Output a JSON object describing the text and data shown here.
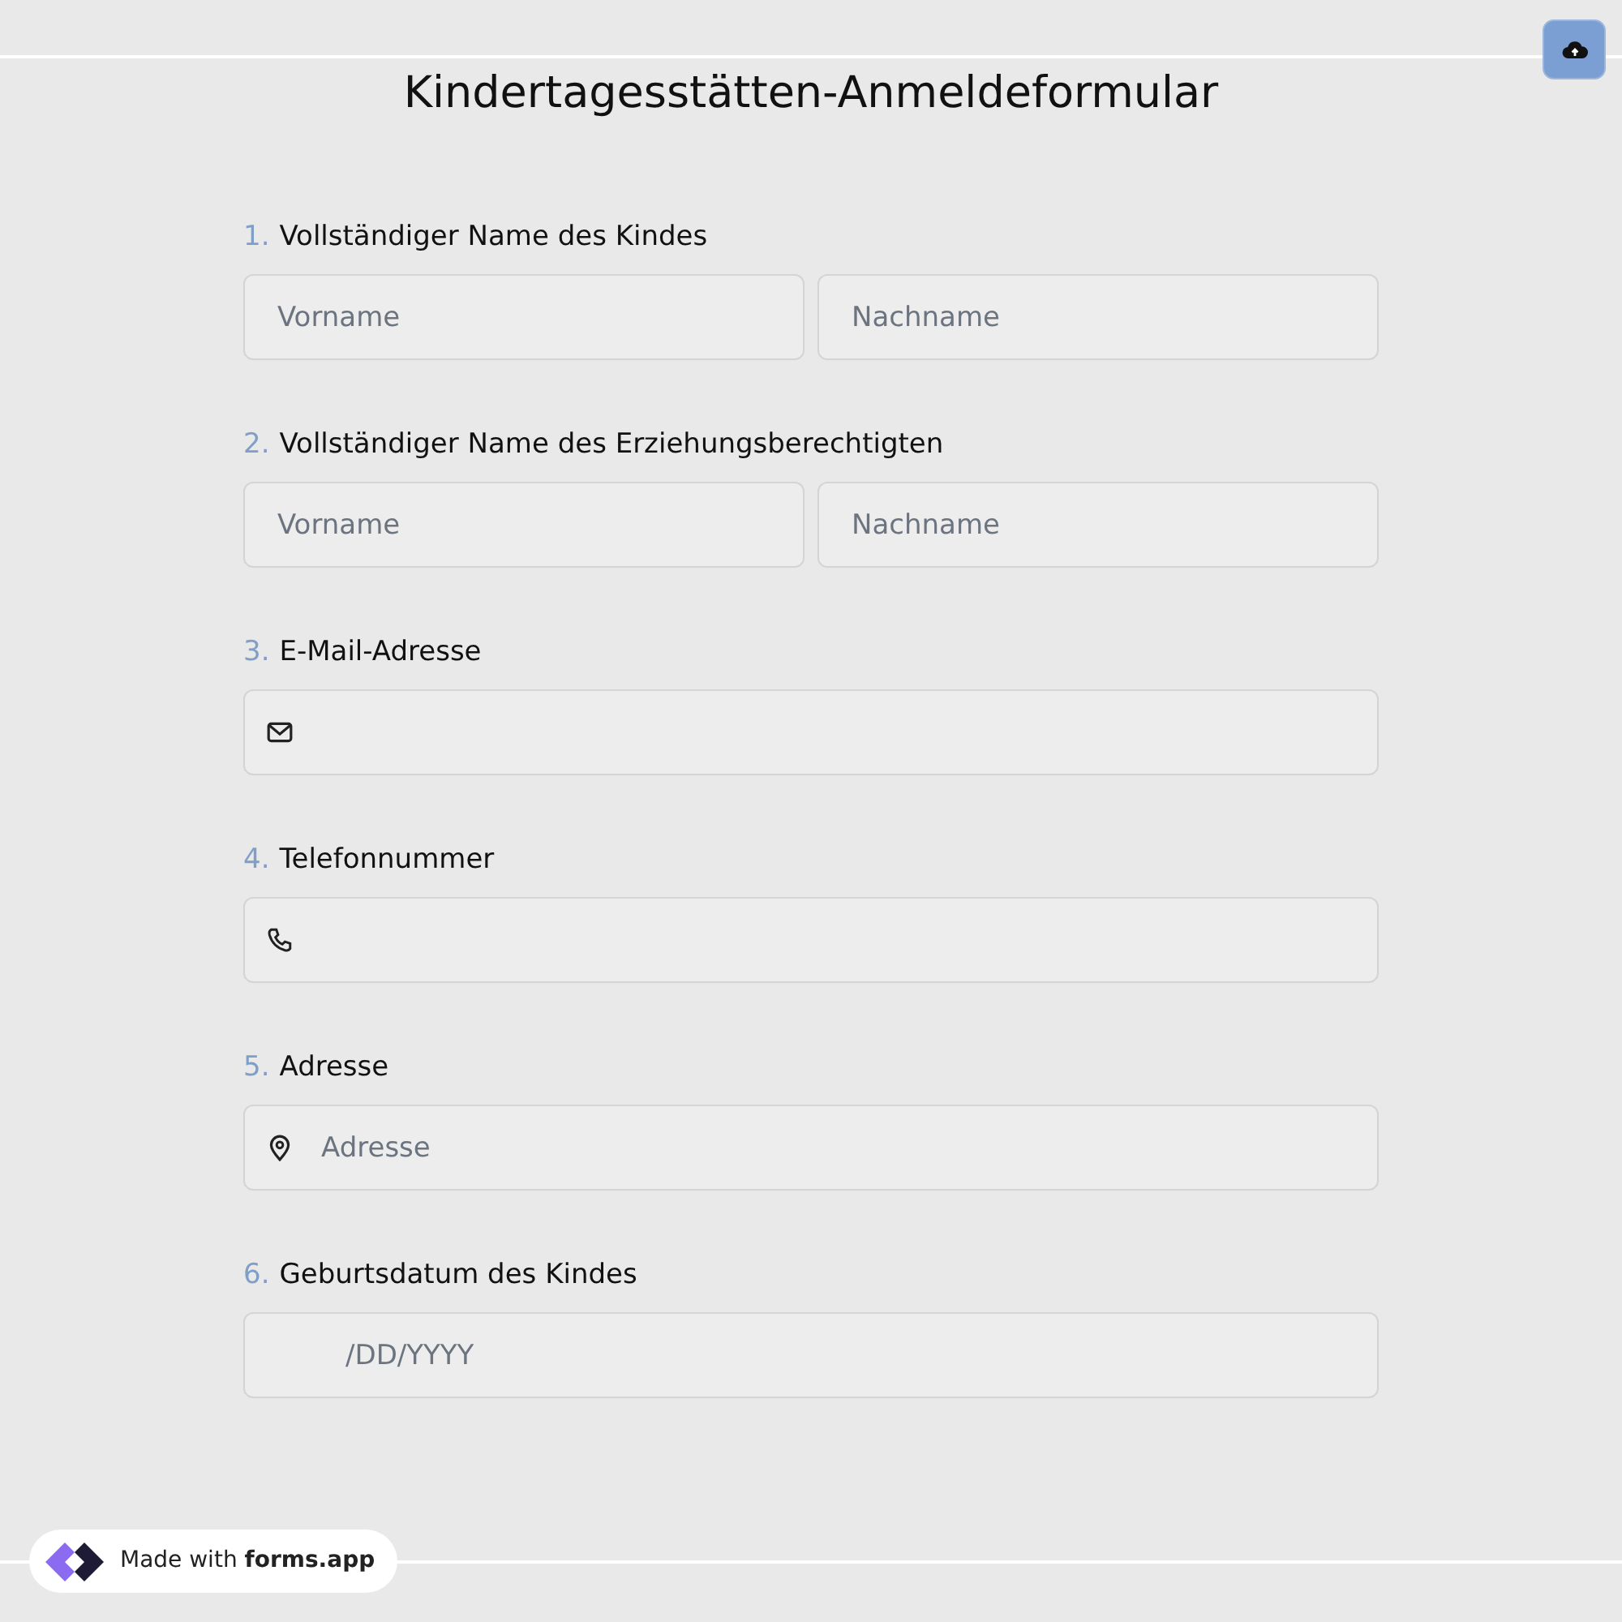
{
  "title": "Kindertagesstätten-Anmeldeformular",
  "questions": [
    {
      "number": "1.",
      "label": "Vollständiger Name des Kindes",
      "kind": "name",
      "fields": [
        {
          "placeholder": "Vorname"
        },
        {
          "placeholder": "Nachname"
        }
      ]
    },
    {
      "number": "2.",
      "label": "Vollständiger Name des Erziehungsberechtigten",
      "kind": "name",
      "fields": [
        {
          "placeholder": "Vorname"
        },
        {
          "placeholder": "Nachname"
        }
      ]
    },
    {
      "number": "3.",
      "label": "E-Mail-Adresse",
      "kind": "email"
    },
    {
      "number": "4.",
      "label": "Telefonnummer",
      "kind": "phone"
    },
    {
      "number": "5.",
      "label": "Adresse",
      "kind": "address",
      "fields": [
        {
          "placeholder": "Adresse"
        }
      ]
    },
    {
      "number": "6.",
      "label": "Geburtsdatum des Kindes",
      "kind": "date",
      "fields": [
        {
          "placeholder": "/DD/YYYY"
        }
      ]
    }
  ],
  "badge": {
    "text": "Made with **forms.app**"
  }
}
